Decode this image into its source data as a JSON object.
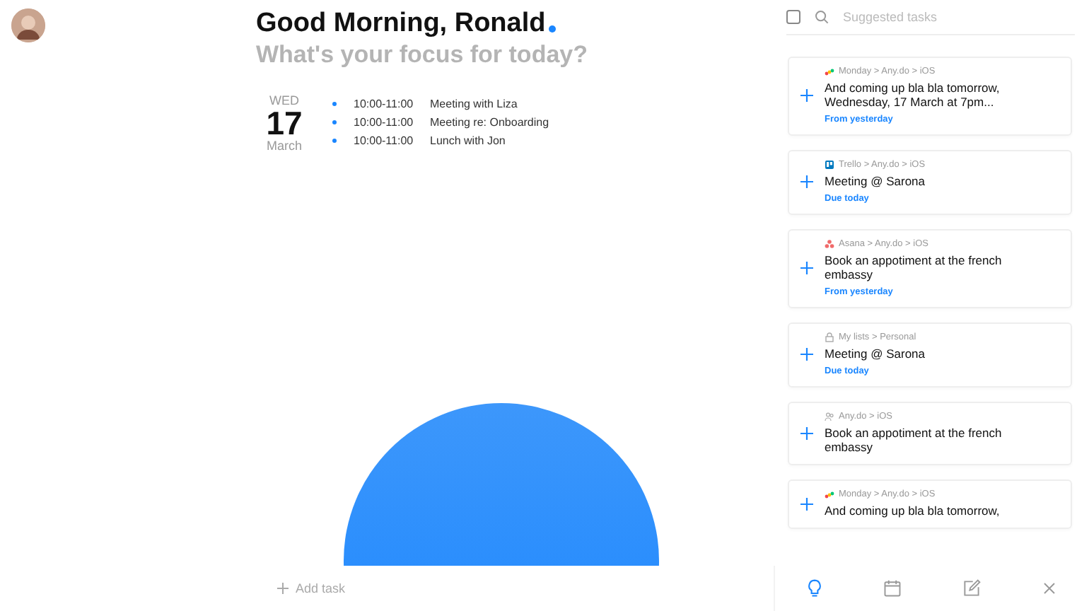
{
  "greeting": {
    "title": "Good Morning, Ronald",
    "subtitle": "What's your focus for today?"
  },
  "date": {
    "weekday": "WED",
    "day": "17",
    "month": "March"
  },
  "events": [
    {
      "time": "10:00-11:00",
      "title": "Meeting with Liza"
    },
    {
      "time": "10:00-11:00",
      "title": "Meeting re: Onboarding"
    },
    {
      "time": "10:00-11:00",
      "title": "Lunch with Jon"
    }
  ],
  "suggestions": {
    "checked": false,
    "placeholder": "Suggested tasks",
    "items": [
      {
        "kind": "monday",
        "path": "Monday > Any.do > iOS",
        "title": "And coming up bla bla tomorrow, Wednesday, 17 March at 7pm...",
        "note": "From yesterday"
      },
      {
        "kind": "trello",
        "path": "Trello > Any.do > iOS",
        "title": "Meeting @ Sarona",
        "note": "Due today"
      },
      {
        "kind": "asana",
        "path": "Asana > Any.do > iOS",
        "title": "Book an appotiment at the french embassy",
        "note": "From yesterday"
      },
      {
        "kind": "lock",
        "path": "My lists > Personal",
        "title": "Meeting @ Sarona",
        "note": "Due today"
      },
      {
        "kind": "people",
        "path": "Any.do > iOS",
        "title": "Book an appotiment at the french embassy"
      },
      {
        "kind": "monday",
        "path": "Monday > Any.do > iOS",
        "title": "And coming up bla bla tomorrow,"
      }
    ]
  },
  "add_task": {
    "placeholder": "Add task"
  },
  "toolbar": [
    {
      "kind": "bulb",
      "selected": true
    },
    {
      "kind": "calendar",
      "selected": false
    },
    {
      "kind": "edit",
      "selected": false
    },
    {
      "kind": "close",
      "selected": false
    }
  ]
}
